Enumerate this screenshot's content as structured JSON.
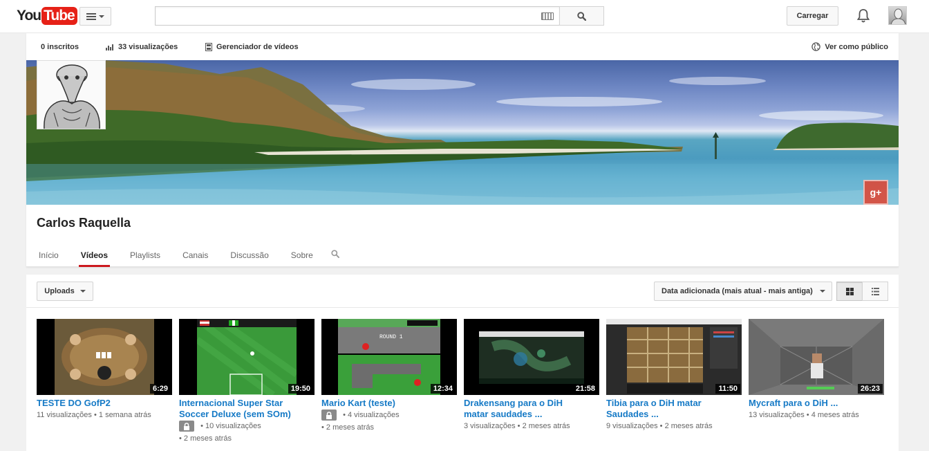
{
  "masthead": {
    "logo_you": "You",
    "logo_tube": "Tube",
    "region": "BR",
    "search_value": "",
    "upload_label": "Carregar"
  },
  "owner_bar": {
    "subscribers": "0 inscritos",
    "views": "33 visualizações",
    "video_manager": "Gerenciador de vídeos",
    "view_as_public": "Ver como público"
  },
  "channel": {
    "name": "Carlos Raquella",
    "gplus_label": "g+",
    "tabs": [
      {
        "label": "Início",
        "active": false
      },
      {
        "label": "Vídeos",
        "active": true
      },
      {
        "label": "Playlists",
        "active": false
      },
      {
        "label": "Canais",
        "active": false
      },
      {
        "label": "Discussão",
        "active": false
      },
      {
        "label": "Sobre",
        "active": false
      }
    ]
  },
  "toolbar": {
    "uploads_label": "Uploads",
    "sort_label": "Data adicionada (mais atual - mais antiga)"
  },
  "videos": [
    {
      "title_line1": "TESTE DO GofP2",
      "title_line2": "",
      "duration": "6:29",
      "views": "11 visualizações",
      "age": "1 semana atrás",
      "private": false
    },
    {
      "title_line1": "Internacional Super Star",
      "title_line2": "Soccer Deluxe (sem SOm)",
      "duration": "19:50",
      "views": "10 visualizações",
      "age": "2 meses atrás",
      "private": true
    },
    {
      "title_line1": "Mario Kart (teste)",
      "title_line2": "",
      "duration": "12:34",
      "views": "4 visualizações",
      "age": "2 meses atrás",
      "private": true
    },
    {
      "title_line1": "Drakensang para o DiH",
      "title_line2": "matar saudades ...",
      "duration": "21:58",
      "views": "3 visualizações",
      "age": "2 meses atrás",
      "private": false
    },
    {
      "title_line1": "Tibia para o DiH matar",
      "title_line2": "Saudades ...",
      "duration": "11:50",
      "views": "9 visualizações",
      "age": "2 meses atrás",
      "private": false
    },
    {
      "title_line1": "Mycraft para o DiH ...",
      "title_line2": "",
      "duration": "26:23",
      "views": "13 visualizações",
      "age": "4 meses atrás",
      "private": false
    }
  ],
  "separator": "•",
  "colors": {
    "brand_red": "#e62117",
    "link_blue": "#167ac6",
    "tab_active": "#cc181e"
  }
}
